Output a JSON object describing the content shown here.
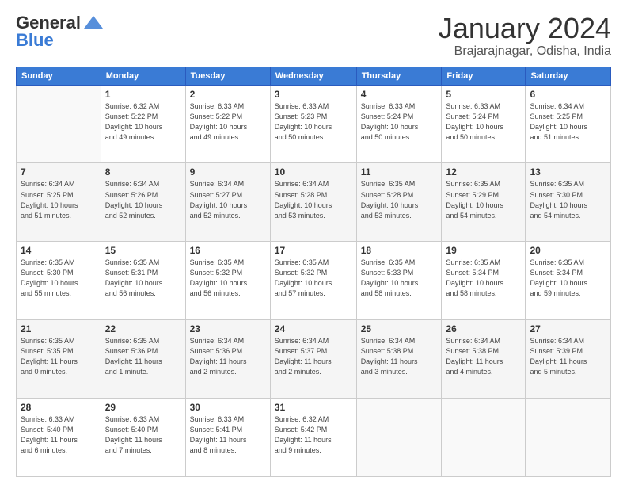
{
  "header": {
    "logo_general": "General",
    "logo_blue": "Blue",
    "month_title": "January 2024",
    "location": "Brajarajnagar, Odisha, India"
  },
  "days_of_week": [
    "Sunday",
    "Monday",
    "Tuesday",
    "Wednesday",
    "Thursday",
    "Friday",
    "Saturday"
  ],
  "weeks": [
    [
      {
        "day": "",
        "info": ""
      },
      {
        "day": "1",
        "info": "Sunrise: 6:32 AM\nSunset: 5:22 PM\nDaylight: 10 hours\nand 49 minutes."
      },
      {
        "day": "2",
        "info": "Sunrise: 6:33 AM\nSunset: 5:22 PM\nDaylight: 10 hours\nand 49 minutes."
      },
      {
        "day": "3",
        "info": "Sunrise: 6:33 AM\nSunset: 5:23 PM\nDaylight: 10 hours\nand 50 minutes."
      },
      {
        "day": "4",
        "info": "Sunrise: 6:33 AM\nSunset: 5:24 PM\nDaylight: 10 hours\nand 50 minutes."
      },
      {
        "day": "5",
        "info": "Sunrise: 6:33 AM\nSunset: 5:24 PM\nDaylight: 10 hours\nand 50 minutes."
      },
      {
        "day": "6",
        "info": "Sunrise: 6:34 AM\nSunset: 5:25 PM\nDaylight: 10 hours\nand 51 minutes."
      }
    ],
    [
      {
        "day": "7",
        "info": "Sunrise: 6:34 AM\nSunset: 5:25 PM\nDaylight: 10 hours\nand 51 minutes."
      },
      {
        "day": "8",
        "info": "Sunrise: 6:34 AM\nSunset: 5:26 PM\nDaylight: 10 hours\nand 52 minutes."
      },
      {
        "day": "9",
        "info": "Sunrise: 6:34 AM\nSunset: 5:27 PM\nDaylight: 10 hours\nand 52 minutes."
      },
      {
        "day": "10",
        "info": "Sunrise: 6:34 AM\nSunset: 5:28 PM\nDaylight: 10 hours\nand 53 minutes."
      },
      {
        "day": "11",
        "info": "Sunrise: 6:35 AM\nSunset: 5:28 PM\nDaylight: 10 hours\nand 53 minutes."
      },
      {
        "day": "12",
        "info": "Sunrise: 6:35 AM\nSunset: 5:29 PM\nDaylight: 10 hours\nand 54 minutes."
      },
      {
        "day": "13",
        "info": "Sunrise: 6:35 AM\nSunset: 5:30 PM\nDaylight: 10 hours\nand 54 minutes."
      }
    ],
    [
      {
        "day": "14",
        "info": "Sunrise: 6:35 AM\nSunset: 5:30 PM\nDaylight: 10 hours\nand 55 minutes."
      },
      {
        "day": "15",
        "info": "Sunrise: 6:35 AM\nSunset: 5:31 PM\nDaylight: 10 hours\nand 56 minutes."
      },
      {
        "day": "16",
        "info": "Sunrise: 6:35 AM\nSunset: 5:32 PM\nDaylight: 10 hours\nand 56 minutes."
      },
      {
        "day": "17",
        "info": "Sunrise: 6:35 AM\nSunset: 5:32 PM\nDaylight: 10 hours\nand 57 minutes."
      },
      {
        "day": "18",
        "info": "Sunrise: 6:35 AM\nSunset: 5:33 PM\nDaylight: 10 hours\nand 58 minutes."
      },
      {
        "day": "19",
        "info": "Sunrise: 6:35 AM\nSunset: 5:34 PM\nDaylight: 10 hours\nand 58 minutes."
      },
      {
        "day": "20",
        "info": "Sunrise: 6:35 AM\nSunset: 5:34 PM\nDaylight: 10 hours\nand 59 minutes."
      }
    ],
    [
      {
        "day": "21",
        "info": "Sunrise: 6:35 AM\nSunset: 5:35 PM\nDaylight: 11 hours\nand 0 minutes."
      },
      {
        "day": "22",
        "info": "Sunrise: 6:35 AM\nSunset: 5:36 PM\nDaylight: 11 hours\nand 1 minute."
      },
      {
        "day": "23",
        "info": "Sunrise: 6:34 AM\nSunset: 5:36 PM\nDaylight: 11 hours\nand 2 minutes."
      },
      {
        "day": "24",
        "info": "Sunrise: 6:34 AM\nSunset: 5:37 PM\nDaylight: 11 hours\nand 2 minutes."
      },
      {
        "day": "25",
        "info": "Sunrise: 6:34 AM\nSunset: 5:38 PM\nDaylight: 11 hours\nand 3 minutes."
      },
      {
        "day": "26",
        "info": "Sunrise: 6:34 AM\nSunset: 5:38 PM\nDaylight: 11 hours\nand 4 minutes."
      },
      {
        "day": "27",
        "info": "Sunrise: 6:34 AM\nSunset: 5:39 PM\nDaylight: 11 hours\nand 5 minutes."
      }
    ],
    [
      {
        "day": "28",
        "info": "Sunrise: 6:33 AM\nSunset: 5:40 PM\nDaylight: 11 hours\nand 6 minutes."
      },
      {
        "day": "29",
        "info": "Sunrise: 6:33 AM\nSunset: 5:40 PM\nDaylight: 11 hours\nand 7 minutes."
      },
      {
        "day": "30",
        "info": "Sunrise: 6:33 AM\nSunset: 5:41 PM\nDaylight: 11 hours\nand 8 minutes."
      },
      {
        "day": "31",
        "info": "Sunrise: 6:32 AM\nSunset: 5:42 PM\nDaylight: 11 hours\nand 9 minutes."
      },
      {
        "day": "",
        "info": ""
      },
      {
        "day": "",
        "info": ""
      },
      {
        "day": "",
        "info": ""
      }
    ]
  ]
}
